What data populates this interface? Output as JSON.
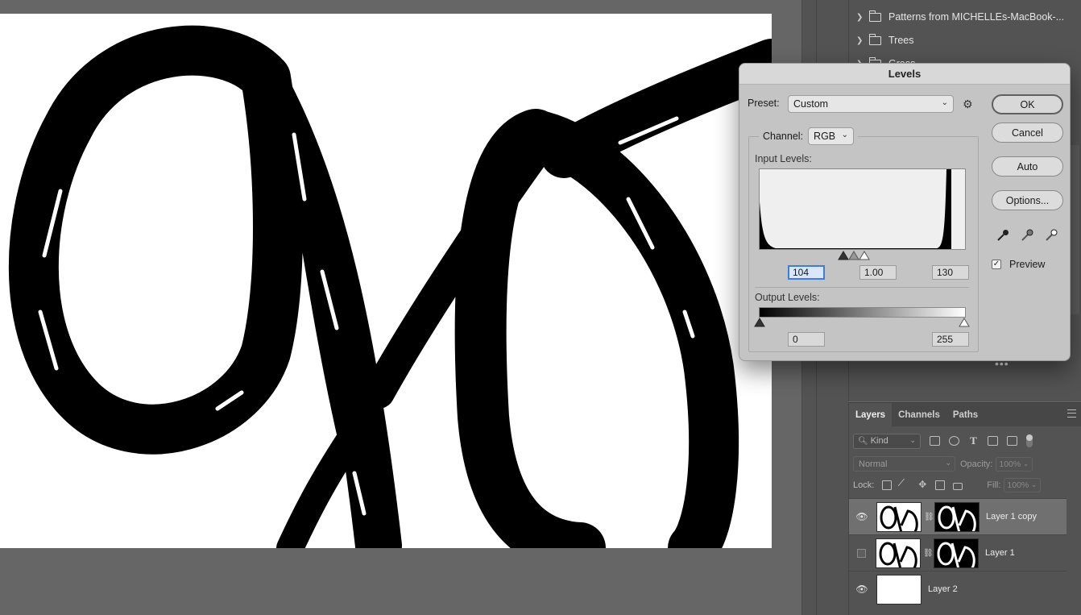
{
  "patterns_panel": {
    "folders": [
      {
        "label": "Patterns from MICHELLEs-MacBook-..."
      },
      {
        "label": "Trees"
      },
      {
        "label": "Grass"
      }
    ],
    "more_label": "•••"
  },
  "layers_panel": {
    "tabs": [
      "Layers",
      "Channels",
      "Paths"
    ],
    "filter_kind": "Kind",
    "blend_mode": "Normal",
    "opacity_label": "Opacity:",
    "opacity_value": "100%",
    "lock_label": "Lock:",
    "fill_label": "Fill:",
    "fill_value": "100%",
    "layers": [
      {
        "name": "Layer 1 copy",
        "visible": true,
        "selected": true
      },
      {
        "name": "Layer 1",
        "visible": false,
        "selected": false
      },
      {
        "name": "Layer 2",
        "visible": true,
        "selected": false
      }
    ]
  },
  "levels_dialog": {
    "title": "Levels",
    "preset_label": "Preset:",
    "preset_value": "Custom",
    "channel_label": "Channel:",
    "channel_value": "RGB",
    "input_levels_label": "Input Levels:",
    "input_black": "104",
    "input_gamma": "1.00",
    "input_white": "130",
    "output_levels_label": "Output Levels:",
    "output_black": "0",
    "output_white": "255",
    "buttons": {
      "ok": "OK",
      "cancel": "Cancel",
      "auto": "Auto",
      "options": "Options..."
    },
    "preview_label": "Preview",
    "preview_checked": true
  },
  "colors": {
    "app_bg": "#666666",
    "panel_bg": "#535353",
    "dialog_bg": "#c4c4c4",
    "focus_blue": "#3d7de0"
  },
  "icons": {
    "eye": "eye-icon",
    "folder": "folder-icon",
    "gear": "gear-icon",
    "link": "link-chain-icon",
    "eyedropper": "eyedropper-icon"
  }
}
